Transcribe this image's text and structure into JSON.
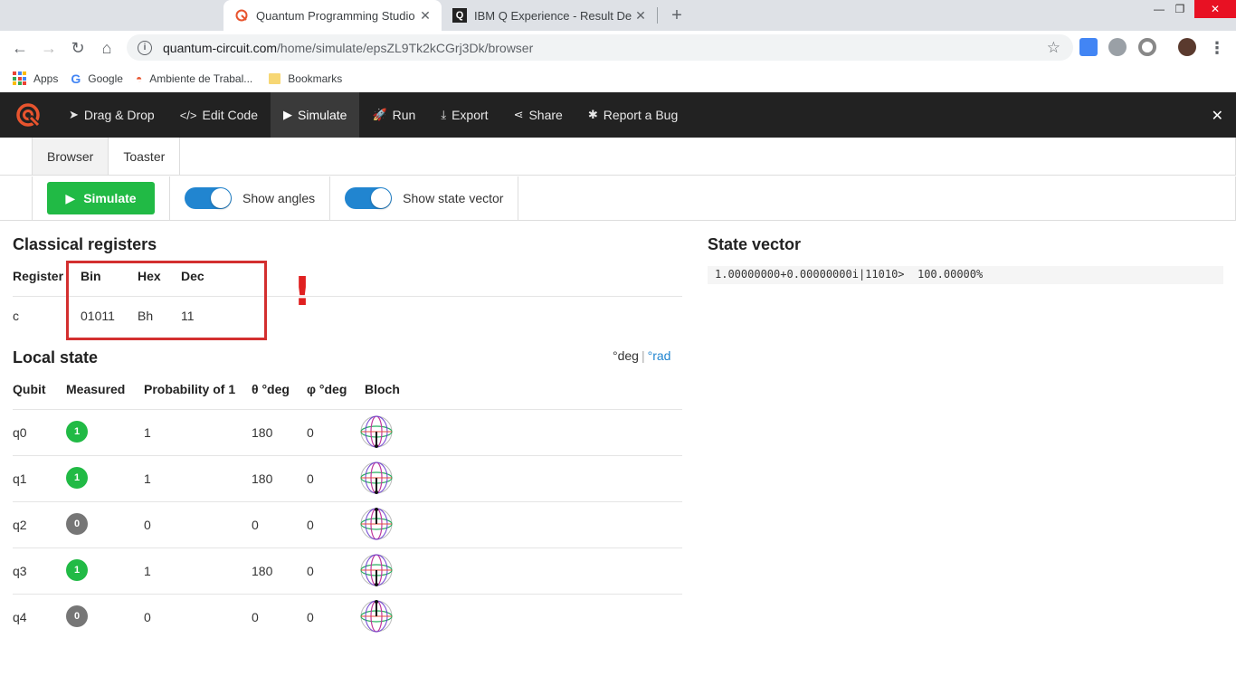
{
  "browser": {
    "tabs": [
      {
        "title": "Quantum Programming Studio",
        "active": true
      },
      {
        "title": "IBM Q Experience - Result Details",
        "active": false
      }
    ],
    "url_host": "quantum-circuit.com",
    "url_path": "/home/simulate/epsZL9Tk2kCGrj3Dk/browser",
    "bookmarks": [
      "Apps",
      "Google",
      "Ambiente de Trabal...",
      "Bookmarks"
    ]
  },
  "nav": {
    "items": [
      "Drag & Drop",
      "Edit Code",
      "Simulate",
      "Run",
      "Export",
      "Share",
      "Report a Bug"
    ],
    "active": "Simulate"
  },
  "subtabs": [
    "Browser",
    "Toaster"
  ],
  "toolbar": {
    "simulate_label": "Simulate",
    "show_angles_label": "Show angles",
    "show_angles": true,
    "show_state_vector_label": "Show state vector",
    "show_state_vector": true
  },
  "classical": {
    "title": "Classical registers",
    "headers": [
      "Register",
      "Bin",
      "Hex",
      "Dec"
    ],
    "rows": [
      [
        "c",
        "01011",
        "Bh",
        "11"
      ]
    ],
    "annotation": "!"
  },
  "local_state": {
    "title": "Local state",
    "units_deg": "°deg",
    "units_sep": "|",
    "units_rad": "°rad",
    "headers": [
      "Qubit",
      "Measured",
      "Probability of 1",
      "θ °deg",
      "φ °deg",
      "Bloch"
    ],
    "rows": [
      {
        "qubit": "q0",
        "measured": "1",
        "prob": "1",
        "theta": "180",
        "phi": "0"
      },
      {
        "qubit": "q1",
        "measured": "1",
        "prob": "1",
        "theta": "180",
        "phi": "0"
      },
      {
        "qubit": "q2",
        "measured": "0",
        "prob": "0",
        "theta": "0",
        "phi": "0"
      },
      {
        "qubit": "q3",
        "measured": "1",
        "prob": "1",
        "theta": "180",
        "phi": "0"
      },
      {
        "qubit": "q4",
        "measured": "0",
        "prob": "0",
        "theta": "0",
        "phi": "0"
      }
    ]
  },
  "state_vector": {
    "title": "State vector",
    "amplitude": "1.00000000+0.00000000i",
    "basis": "|11010>",
    "probability": "100.00000%"
  },
  "colors": {
    "accent_green": "#21ba45",
    "accent_blue": "#2185d0",
    "nav_bg": "#222222",
    "logo_orange": "#e8542e"
  }
}
